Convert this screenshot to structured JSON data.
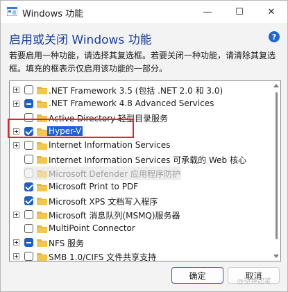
{
  "window": {
    "title": "Windows 功能",
    "minimize_glyph": "—",
    "maximize_glyph": "☐",
    "close_glyph": "✕"
  },
  "header": {
    "heading": "启用或关闭 Windows 功能",
    "help_glyph": "?",
    "description_line1": "若要启用一种功能，请选择其复选框。若要关闭一种功能，请清除其复选",
    "description_line2": "框。填充的框表示仅启用该功能的一部分。"
  },
  "features": [
    {
      "label": ".NET Framework 3.5 (包括 .NET 2.0 和 3.0)",
      "expandable": true,
      "state": "unchecked"
    },
    {
      "label": ".NET Framework 4.8 Advanced Services",
      "expandable": true,
      "state": "partial"
    },
    {
      "label": "Active Directory 轻型目录服务",
      "expandable": false,
      "state": "unchecked"
    },
    {
      "label": "Hyper-V",
      "expandable": true,
      "state": "checked",
      "selected": true
    },
    {
      "label": "Internet Information Services",
      "expandable": true,
      "state": "unchecked"
    },
    {
      "label": "Internet Information Services 可承载的 Web 核心",
      "expandable": false,
      "state": "unchecked"
    },
    {
      "label": "Microsoft Defender 应用程序防护",
      "expandable": false,
      "state": "disabled"
    },
    {
      "label": "Microsoft Print to PDF",
      "expandable": false,
      "state": "checked"
    },
    {
      "label": "Microsoft XPS 文档写入程序",
      "expandable": false,
      "state": "checked"
    },
    {
      "label": "Microsoft 消息队列(MSMQ)服务器",
      "expandable": true,
      "state": "unchecked"
    },
    {
      "label": "MultiPoint Connector",
      "expandable": false,
      "state": "unchecked"
    },
    {
      "label": "NFS 服务",
      "expandable": true,
      "state": "partial"
    },
    {
      "label": "SMB 1.0/CIFS 文件共享支持",
      "expandable": true,
      "state": "unchecked"
    }
  ],
  "buttons": {
    "ok": "确定",
    "cancel": "取消"
  },
  "watermark": "@逆锋起笔",
  "colors": {
    "accent": "#1e5fc7",
    "heading": "#1a3f9c",
    "highlight_box": "#e2222c",
    "folder": "#f3c64c"
  },
  "icons": {
    "app": "windows-features-icon",
    "expander": "plus-box-icon",
    "item": "folder-icon",
    "help": "question-icon"
  }
}
